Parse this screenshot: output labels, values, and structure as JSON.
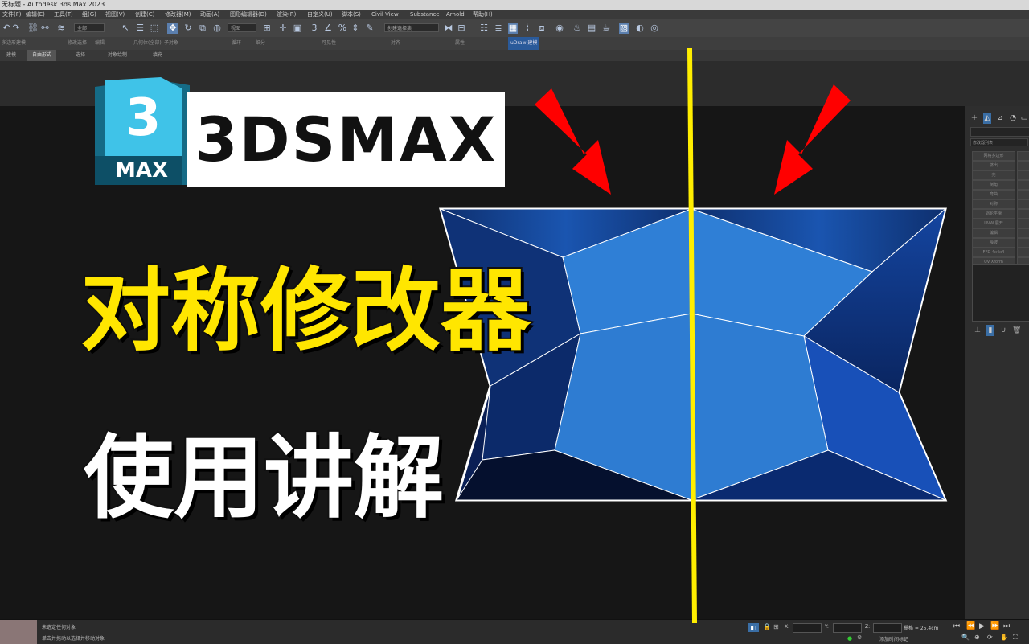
{
  "app": {
    "window_title": "无标题 - Autodesk 3ds Max 2023"
  },
  "menu": [
    "文件(F)",
    "编辑(E)",
    "工具(T)",
    "组(G)",
    "视图(V)",
    "创建(C)",
    "修改器(M)",
    "动画(A)",
    "图形编辑器(D)",
    "渲染(R)",
    "自定义(U)",
    "脚本(S)",
    "Civil View",
    "Substance",
    "Arnold",
    "帮助(H)"
  ],
  "toolbar": {
    "selection_filter": "全部",
    "coordinate_system": "视图",
    "named_selection_placeholder": "创建选择集"
  },
  "ribbon": {
    "items": [
      "多边形建模",
      "修改选择",
      "编辑",
      "几何体(全部)",
      "子对象",
      "循环",
      "细分",
      "可见性",
      "对齐",
      "属性"
    ],
    "highlight": "uDraw 建模"
  },
  "subtabs": [
    "建模",
    "自由形式",
    "选择",
    "对象绘制",
    "填充"
  ],
  "overlay": {
    "logo_number": "3",
    "logo_text": "MAX",
    "badge_text": "3DSMAX",
    "title_line1": "对称修改器",
    "title_line2": "使用讲解"
  },
  "command_panel": {
    "modifier_list": "修改器列表",
    "buttons": [
      "网格多边形",
      "挤出",
      "壳",
      "倒角",
      "弯曲",
      "对称",
      "涡轮平滑",
      "UVW 展开",
      "编辑",
      "噪波",
      "FFD 4x4x4",
      "UV Xform"
    ]
  },
  "status": {
    "selection": "未选定任何对象",
    "prompt": "单击并拖动以选择并移动对象",
    "x_label": "X:",
    "y_label": "Y:",
    "z_label": "Z:",
    "grid": "栅格 = 25.4cm",
    "add_time_tag": "添加时间标记"
  },
  "colors": {
    "accent_yellow": "#ffe600",
    "arrow_red": "#ff0000",
    "mesh_blue": "#2f7fd6",
    "mirror_line": "#ffee00"
  }
}
